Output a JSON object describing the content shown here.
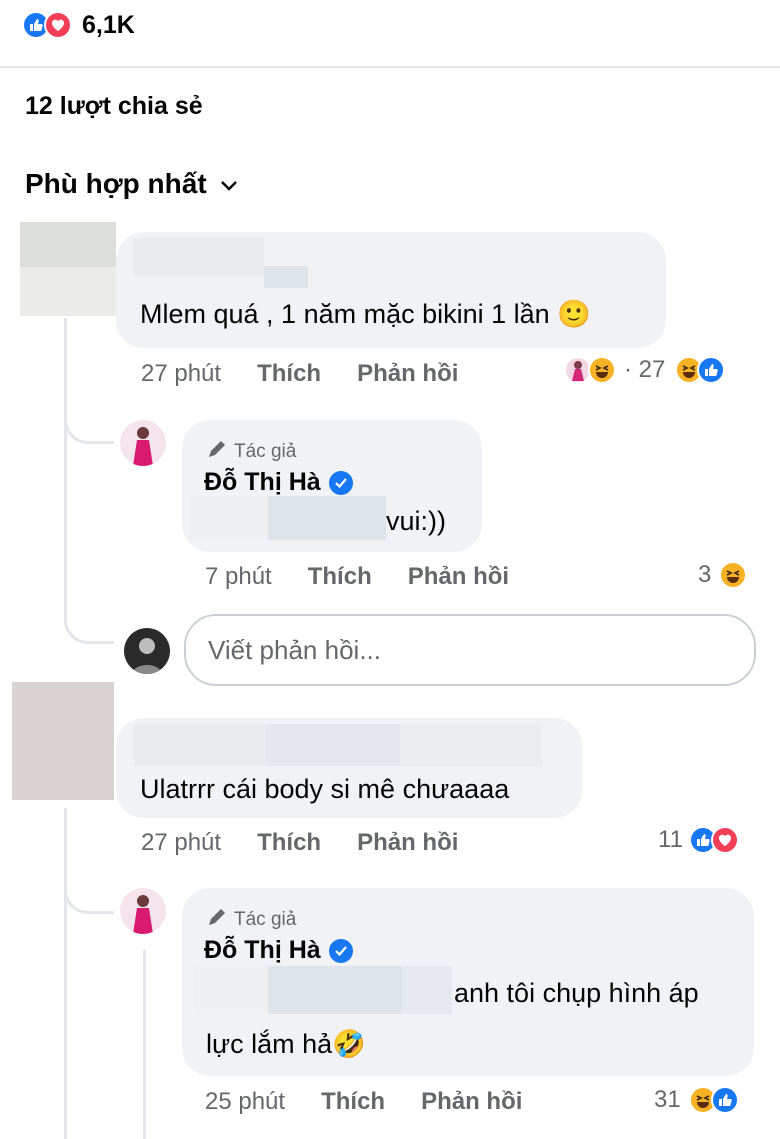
{
  "post": {
    "reaction_count": "6,1K",
    "shares": "12 lượt chia sẻ",
    "sort_label": "Phù hợp nhất"
  },
  "comments": [
    {
      "text": "Mlem quá , 1 năm mặc bikini 1 lần 🙂",
      "time": "27 phút",
      "like": "Thích",
      "reply": "Phản hồi",
      "reaction_count_left": "· 27",
      "replies": [
        {
          "author_tag": "Tác giả",
          "author_name": "Đỗ Thị Hà",
          "text": "vui:))",
          "time": "7 phút",
          "like": "Thích",
          "reply": "Phản hồi",
          "reaction_count": "3"
        }
      ],
      "reply_placeholder": "Viết phản hồi..."
    },
    {
      "text": "Ulatrrr cái body si mê chưaaaa",
      "time": "27 phút",
      "like": "Thích",
      "reply": "Phản hồi",
      "reaction_count": "11",
      "replies": [
        {
          "author_tag": "Tác giả",
          "author_name": "Đỗ Thị Hà",
          "text_line1": "anh tôi chụp hình áp",
          "text_line2": "lực lắm hả🤣",
          "time": "25 phút",
          "like": "Thích",
          "reply": "Phản hồi",
          "reaction_count": "31"
        }
      ]
    }
  ],
  "colors": {
    "like_blue": "#1877f2",
    "love_red": "#f33e58",
    "haha_yellow": "#f7b125",
    "bubble_bg": "#f0f2f5",
    "meta_gray": "#65676b"
  },
  "icons": [
    "like-icon",
    "love-icon",
    "haha-icon",
    "chevron-down-icon",
    "pen-icon",
    "verified-icon"
  ]
}
